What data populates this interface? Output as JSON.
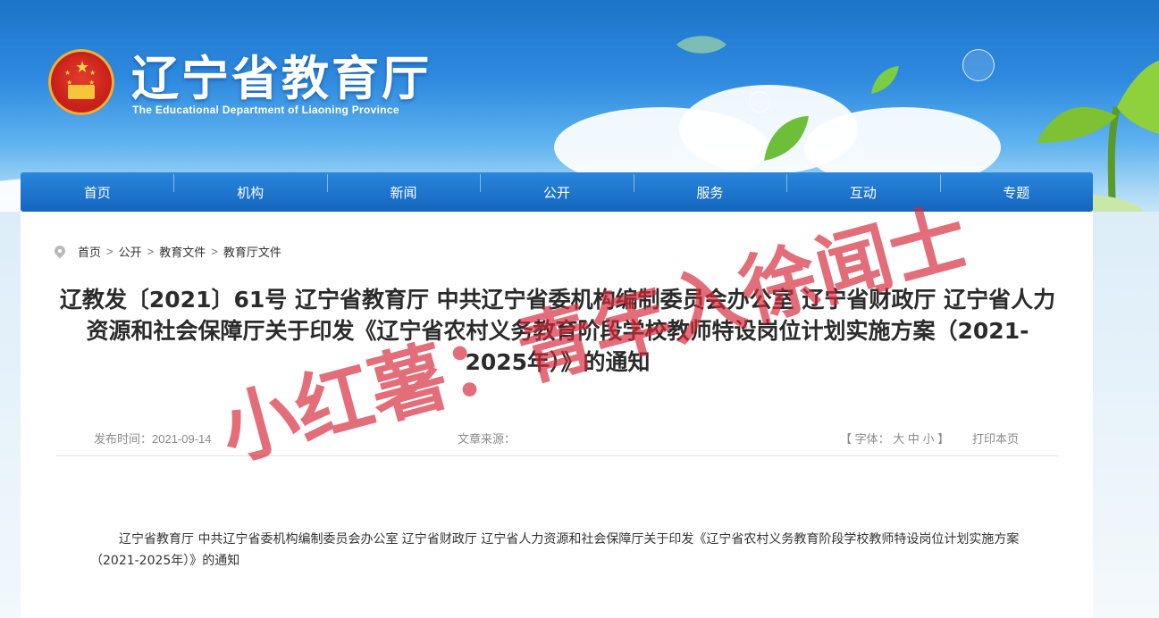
{
  "header": {
    "title": "辽宁省教育厅",
    "subtitle": "The Educational Department of Liaoning Province"
  },
  "nav": {
    "items": [
      {
        "label": "首页"
      },
      {
        "label": "机构"
      },
      {
        "label": "新闻"
      },
      {
        "label": "公开"
      },
      {
        "label": "服务"
      },
      {
        "label": "互动"
      },
      {
        "label": "专题"
      }
    ]
  },
  "breadcrumb": [
    "首页",
    "公开",
    "教育文件",
    "教育厅文件"
  ],
  "breadcrumb_separator": ">",
  "article": {
    "title": "辽教发〔2021〕61号 辽宁省教育厅 中共辽宁省委机构编制委员会办公室 辽宁省财政厅 辽宁省人力资源和社会保障厅关于印发《辽宁省农村义务教育阶段学校教师特设岗位计划实施方案（2021-2025年）》的通知",
    "publish_time_label": "发布时间：",
    "publish_time": "2021-09-14",
    "source_label": "文章来源：",
    "source": "",
    "font_size": {
      "open": "【",
      "label": "字体：",
      "large": "大",
      "medium": "中",
      "small": "小",
      "close": "】"
    },
    "print_label": "打印本页",
    "body": "辽宁省教育厅 中共辽宁省委机构编制委员会办公室 辽宁省财政厅 辽宁省人力资源和社会保障厅关于印发《辽宁省农村义务教育阶段学校教师特设岗位计划实施方案（2021-2025年）》的通知"
  },
  "watermark": "小红薯：青年入徐闻士",
  "colors": {
    "nav": "#1a6fc6",
    "watermark": "#d6283a",
    "title": "#2b2b2b"
  },
  "icons": {
    "emblem": "national-emblem-icon",
    "breadcrumb": "location-pin-icon"
  }
}
